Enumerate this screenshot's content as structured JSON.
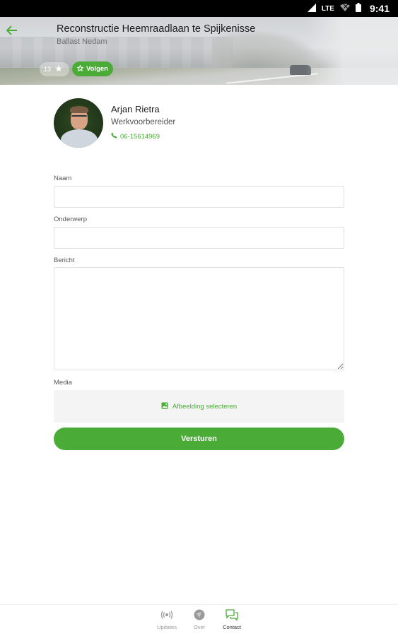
{
  "status_bar": {
    "network": "LTE",
    "time": "9:41"
  },
  "header": {
    "title": "Reconstructie Heemraadlaan te Spijkenisse",
    "subtitle": "Ballast Nedam",
    "counter": "13",
    "follow_label": "Volgen"
  },
  "contact": {
    "name": "Arjan Rietra",
    "role": "Werkvoorbereider",
    "phone": "06-15614969"
  },
  "form": {
    "name_label": "Naam",
    "name_value": "",
    "subject_label": "Onderwerp",
    "subject_value": "",
    "message_label": "Bericht",
    "message_value": "",
    "media_label": "Media",
    "media_button": "Afbeelding selecteren",
    "submit_label": "Versturen"
  },
  "bottom_nav": [
    {
      "label": "Updates",
      "icon": "broadcast-icon",
      "active": false
    },
    {
      "label": "Over",
      "icon": "info-icon",
      "active": false
    },
    {
      "label": "Contact",
      "icon": "chat-icon",
      "active": true
    }
  ],
  "colors": {
    "accent": "#4aac37",
    "status_bar": "#000000"
  }
}
